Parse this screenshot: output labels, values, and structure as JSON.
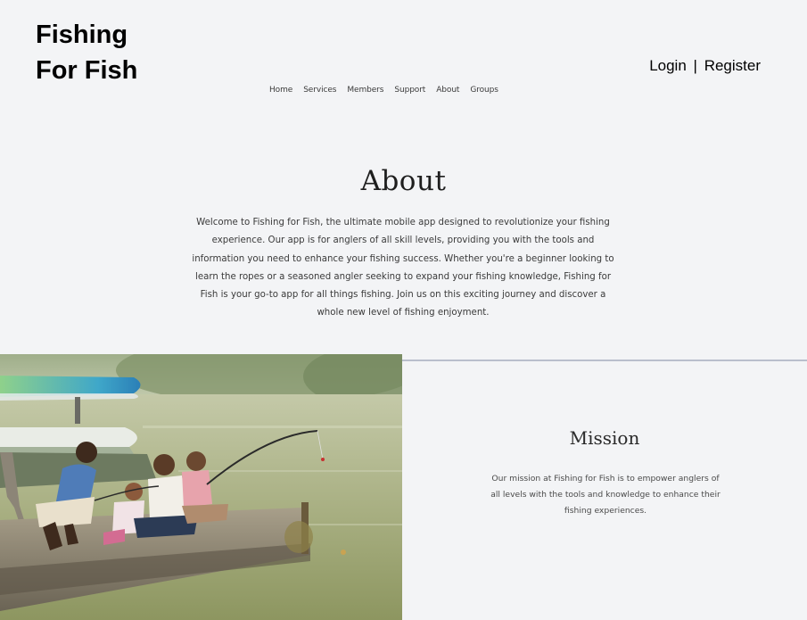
{
  "header": {
    "brand_line1": "Fishing",
    "brand_line2": "For Fish",
    "login_label": "Login",
    "separator": "|",
    "register_label": "Register"
  },
  "nav": {
    "items": [
      {
        "label": "Home"
      },
      {
        "label": "Services"
      },
      {
        "label": "Members"
      },
      {
        "label": "Support"
      },
      {
        "label": "About"
      },
      {
        "label": "Groups"
      }
    ]
  },
  "about": {
    "title": "About",
    "body": "Welcome to Fishing for Fish, the ultimate mobile app designed to revolutionize your fishing experience. Our app is for anglers of all skill levels, providing you with the tools and information you need to enhance your fishing success. Whether you're a beginner looking to learn the ropes or a seasoned angler seeking to expand your fishing knowledge, Fishing for Fish is your go-to app for all things fishing. Join us on this exciting journey and discover a whole new level of fishing enjoyment."
  },
  "photo": {
    "alt": "family-fishing-photo"
  },
  "mission": {
    "title": "Mission",
    "body": "Our mission at Fishing for Fish is to empower anglers of all levels with the tools and knowledge to enhance their fishing experiences."
  },
  "colors": {
    "background": "#f3f4f6",
    "divider": "#b9bfcc",
    "text": "#3a3a3a"
  }
}
